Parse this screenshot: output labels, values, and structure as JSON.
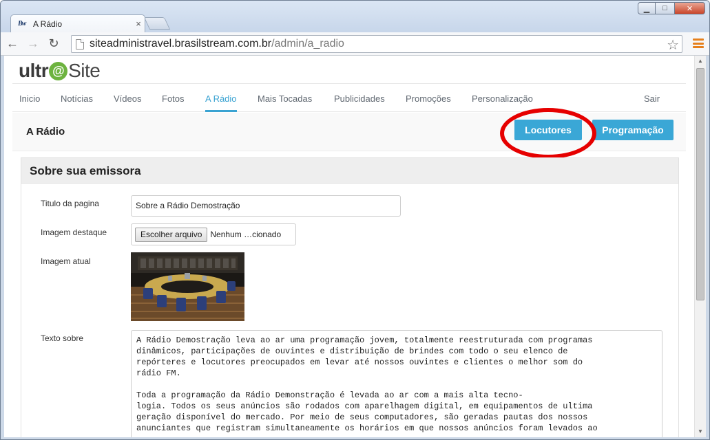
{
  "browser": {
    "tab_title": "A Rádio",
    "tab_favicon": "Bw",
    "url_host": "siteadministravel.brasilstream.com.br",
    "url_path": "/admin/a_radio",
    "icons": {
      "back": "←",
      "forward": "→",
      "reload": "↻",
      "star": "☆",
      "close": "×",
      "minimize": "▁",
      "maximize": "□",
      "window_close": "✕"
    }
  },
  "logo": {
    "part1": "ultr",
    "at": "@",
    "part2": "Site"
  },
  "nav": {
    "items": [
      "Inicio",
      "Notícias",
      "Vídeos",
      "Fotos",
      "A Rádio",
      "Mais Tocadas",
      "Publicidades",
      "Promoções",
      "Personalização"
    ],
    "active": "A Rádio",
    "logout": "Sair"
  },
  "section": {
    "title": "A Rádio",
    "buttons": {
      "locutores": "Locutores",
      "programacao": "Programação"
    },
    "highlight_color": "#e60000",
    "accent_color": "#3aa7d6"
  },
  "form": {
    "card_title": "Sobre sua emissora",
    "labels": {
      "titulo": "Titulo da pagina",
      "imagem_destaque": "Imagem destaque",
      "imagem_atual": "Imagem atual",
      "texto_sobre": "Texto sobre"
    },
    "titulo_value": "Sobre a Rádio Demostração",
    "file_button": "Escolher arquivo",
    "file_name": "Nenhum …cionado",
    "texto_value": "A Rádio Demostração leva ao ar uma programação jovem, totalmente reestruturada com programas\ndinâmicos, participações de ouvintes e distribuição de brindes com todo o seu elenco de\nrepórteres e locutores preocupados em levar até nossos ouvintes e clientes o melhor som do\nrádio FM.\n\nToda a programação da Rádio Demonstração é levada ao ar com a mais alta tecno-\nlogia. Todos os seus anúncios são rodados com aparelhagem digital, em equipamentos de ultima\ngeração disponível do mercado. Por meio de seus computadores, são geradas pautas dos nossos\nanunciantes que registram simultaneamente os horários em que nossos anúncios foram levados ao"
  },
  "scrollbar": {
    "up": "▲",
    "down": "▼"
  }
}
